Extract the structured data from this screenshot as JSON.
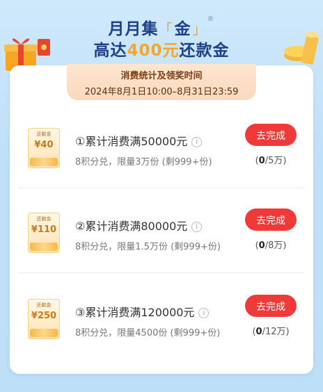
{
  "header": {
    "title_prefix": "月月集",
    "title_bracket_open": "「",
    "title_char": "金",
    "title_bracket_close": "」",
    "title_mark": "®",
    "subtitle_prefix": "高达",
    "subtitle_amount": "400元",
    "subtitle_suffix": "还款金"
  },
  "period": {
    "title": "消费统计及领奖时间",
    "dates": "2024年8月1日10:00–8月31日23:59"
  },
  "tasks": [
    {
      "coupon_label": "还款金",
      "coupon_value": "¥40",
      "title": "①累计消费满50000元",
      "subtitle": "8积分兑，限量3万份 (剩999+份)",
      "button": "去完成",
      "progress_open": "(",
      "progress_done": "0",
      "progress_rest": "/5万)"
    },
    {
      "coupon_label": "还款金",
      "coupon_value": "¥110",
      "title": "②累计消费满80000元",
      "subtitle": "8积分兑，限量1.5万份 (剩999+份)",
      "button": "去完成",
      "progress_open": "(",
      "progress_done": "0",
      "progress_rest": "/8万)"
    },
    {
      "coupon_label": "还款金",
      "coupon_value": "¥250",
      "title": "③累计消费满120000元",
      "subtitle": "8积分兑，限量4500份 (剩999+份)",
      "button": "去完成",
      "progress_open": "(",
      "progress_done": "0",
      "progress_rest": "/12万)"
    }
  ],
  "info_glyph": "i",
  "colors": {
    "accent_red": "#f03a3a",
    "title_blue": "#1d3f8a",
    "amount_gold": "#f2a72b"
  },
  "icons": [
    "gift-box-icon",
    "red-envelope-icon",
    "coins-icon",
    "info-icon"
  ]
}
